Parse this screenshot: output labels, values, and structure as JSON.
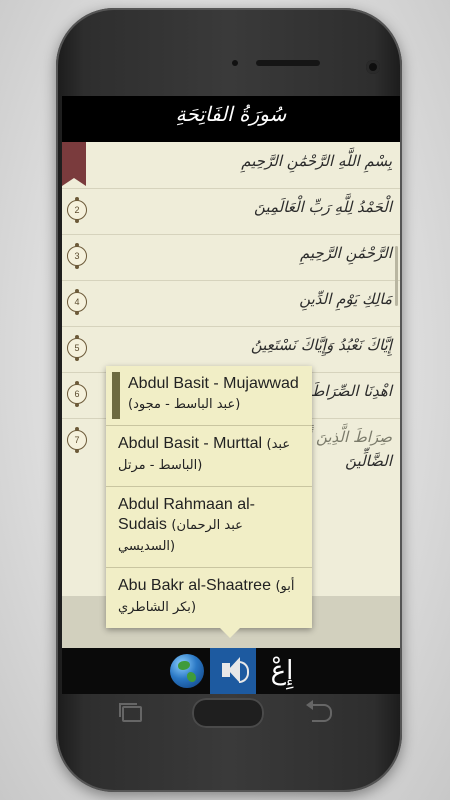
{
  "app": {
    "surah_title": "سُورَةُ الفَاتِحَةِ"
  },
  "ayahs": [
    {
      "number": "",
      "text": "بِسْمِ اللَّهِ الرَّحْمَٰنِ الرَّحِيمِ"
    },
    {
      "number": "2",
      "text": "الْحَمْدُ لِلَّهِ رَبِّ الْعَالَمِينَ"
    },
    {
      "number": "3",
      "text": "الرَّحْمَٰنِ الرَّحِيمِ"
    },
    {
      "number": "4",
      "text": "مَالِكِ يَوْمِ الدِّينِ"
    },
    {
      "number": "5",
      "text": "إِيَّاكَ نَعْبُدُ وَإِيَّاكَ نَسْتَعِينُ"
    },
    {
      "number": "6",
      "text": "اهْدِنَا الصِّرَاطَ الْمُسْتَقِيمَ"
    },
    {
      "number": "7",
      "text": "صِرَاطَ الَّذِينَ أَنْعَمْتَ عَلَيْهِمْ غَيْرِ الْمَغْضُوبِ"
    },
    {
      "number": "",
      "text": "الضَّالِّينَ"
    }
  ],
  "reciter_menu": {
    "items": [
      {
        "name": "Abdul Basit - Mujawwad",
        "arabic": "(عبد الباسط - مجود)",
        "selected": true
      },
      {
        "name": "Abdul Basit - Murttal",
        "arabic": "(عبد الباسط - مرتل)",
        "selected": false
      },
      {
        "name": "Abdul Rahmaan al-Sudais",
        "arabic": "(عبد الرحمان السديسي)",
        "selected": false
      },
      {
        "name": "Abu Bakr al-Shaatree",
        "arabic": "(أبو بكر الشاطري)",
        "selected": false
      }
    ]
  },
  "toolbar": {
    "globe_icon": "globe-icon",
    "audio_icon": "speaker-icon",
    "erab_label": "إِعْ"
  },
  "colors": {
    "accent": "#1d5aa0",
    "popup_bg": "#f1eec6",
    "selection_bar": "#6d6a40",
    "bookmark": "#7a3b3d"
  }
}
